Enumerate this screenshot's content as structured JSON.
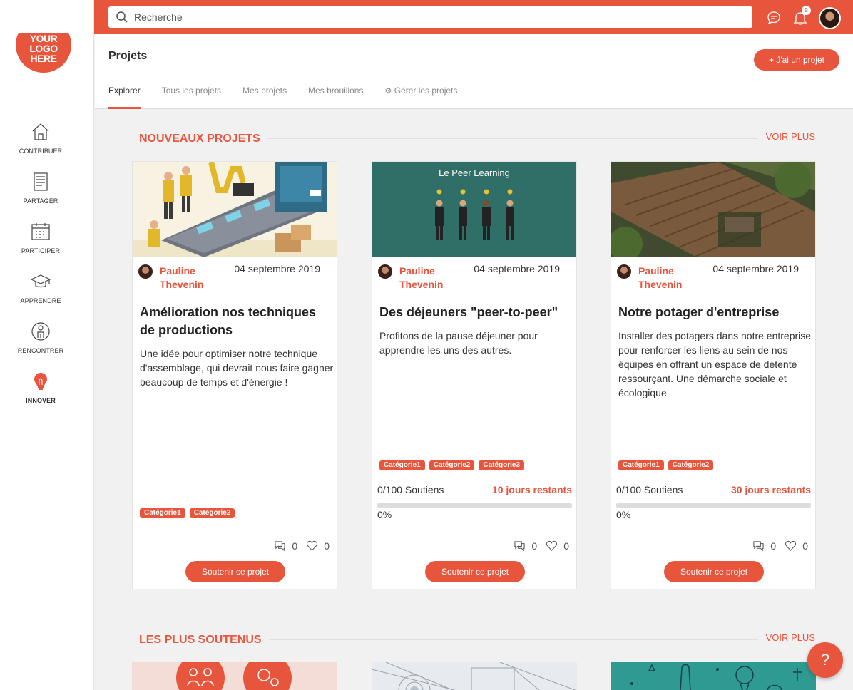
{
  "logo": {
    "lines": [
      "YOUR",
      "LOGO",
      "HERE"
    ]
  },
  "sidebar": {
    "items": [
      {
        "label": "CONTRIBUER",
        "icon": "home-icon"
      },
      {
        "label": "PARTAGER",
        "icon": "document-icon"
      },
      {
        "label": "PARTICIPER",
        "icon": "calendar-icon"
      },
      {
        "label": "APPRENDRE",
        "icon": "graduation-cap-icon"
      },
      {
        "label": "RENCONTRER",
        "icon": "person-icon"
      },
      {
        "label": "INNOVER",
        "icon": "lightbulb-icon",
        "active": true
      }
    ]
  },
  "topbar": {
    "search_placeholder": "Recherche",
    "notifications_count": "9"
  },
  "header": {
    "title": "Projets",
    "add_button": "+ J'ai un projet",
    "tabs": [
      {
        "label": "Explorer",
        "active": true
      },
      {
        "label": "Tous les projets"
      },
      {
        "label": "Mes projets"
      },
      {
        "label": "Mes brouillons"
      },
      {
        "label": "Gérer les projets"
      }
    ]
  },
  "sections": [
    {
      "title": "NOUVEAUX PROJETS",
      "more": "VOIR PLUS"
    },
    {
      "title": "LES PLUS SOUTENUS",
      "more": "VOIR PLUS"
    }
  ],
  "cards": [
    {
      "author": "Pauline Thevenin",
      "date": "04 septembre 2019",
      "title": "Amélioration nos techniques de productions",
      "description": "Une idée pour optimiser notre technique d'assemblage, qui devrait nous faire gagner beaucoup de temps et d'énergie !",
      "categories": [
        "Catégorie1",
        "Catégorie2"
      ],
      "comments": "0",
      "likes": "0",
      "button": "Soutenir ce projet"
    },
    {
      "author": "Pauline Thevenin",
      "date": "04 septembre 2019",
      "image_caption": "Le Peer Learning",
      "title": "Des déjeuners \"peer-to-peer\"",
      "description": "Profitons de la pause déjeuner pour apprendre les uns des autres.",
      "categories": [
        "Catégorie1",
        "Catégorie2",
        "Catégorie3"
      ],
      "supports": "0/100 Soutiens",
      "days_left": "10 jours restants",
      "progress_percent": 0,
      "percent_label": "0%",
      "comments": "0",
      "likes": "0",
      "button": "Soutenir ce projet"
    },
    {
      "author": "Pauline Thevenin",
      "date": "04 septembre 2019",
      "title": "Notre potager d'entreprise",
      "description": "Installer des potagers dans notre entreprise pour renforcer les liens au sein de nos équipes en offrant un espace de détente ressourçant. Une démarche sociale et écologique",
      "categories": [
        "Catégorie1",
        "Catégorie2"
      ],
      "supports": "0/100 Soutiens",
      "days_left": "30 jours restants",
      "progress_percent": 0,
      "percent_label": "0%",
      "comments": "0",
      "likes": "0",
      "button": "Soutenir ce projet"
    }
  ],
  "help": "?",
  "colors": {
    "accent": "#e8553d",
    "background": "#f1f1f1"
  }
}
